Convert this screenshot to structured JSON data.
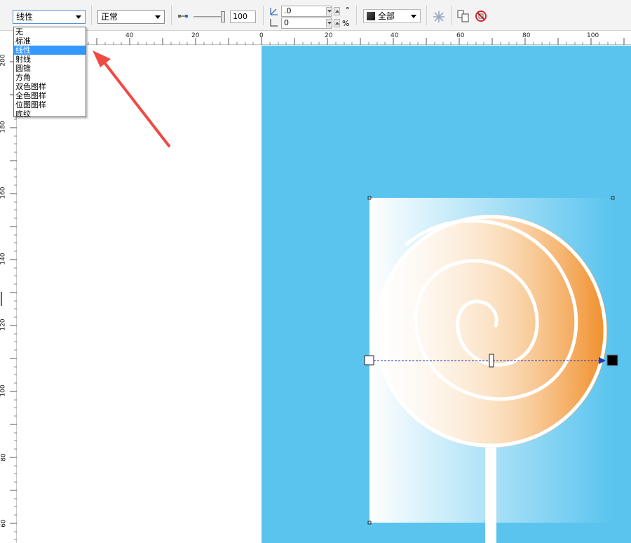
{
  "toolbar": {
    "fill_type": "线性",
    "merge_mode": "正常",
    "transparency_value": "100",
    "angle_value": ".0",
    "angle_unit": "°",
    "edge_pad_value": "0",
    "edge_pad_unit": "%",
    "apply_target": "全部"
  },
  "fill_dropdown": {
    "options": [
      "无",
      "标准",
      "线性",
      "射线",
      "圆锥",
      "方角",
      "双色图样",
      "全色图样",
      "位图图样",
      "底纹"
    ],
    "selected_index": 2
  },
  "rulers": {
    "horizontal": [
      "40",
      "20",
      "0",
      "20",
      "40",
      "60",
      "80",
      "100"
    ],
    "vertical": [
      "200",
      "180",
      "160",
      "140",
      "120",
      "100",
      "80",
      "60"
    ]
  },
  "colors": {
    "stage_background": "#5ac4ef",
    "candy_orange": "#f0902a",
    "annotation_arrow": "#ef4a44",
    "gradient_start": "#ffffff",
    "gradient_end": "#000000"
  }
}
